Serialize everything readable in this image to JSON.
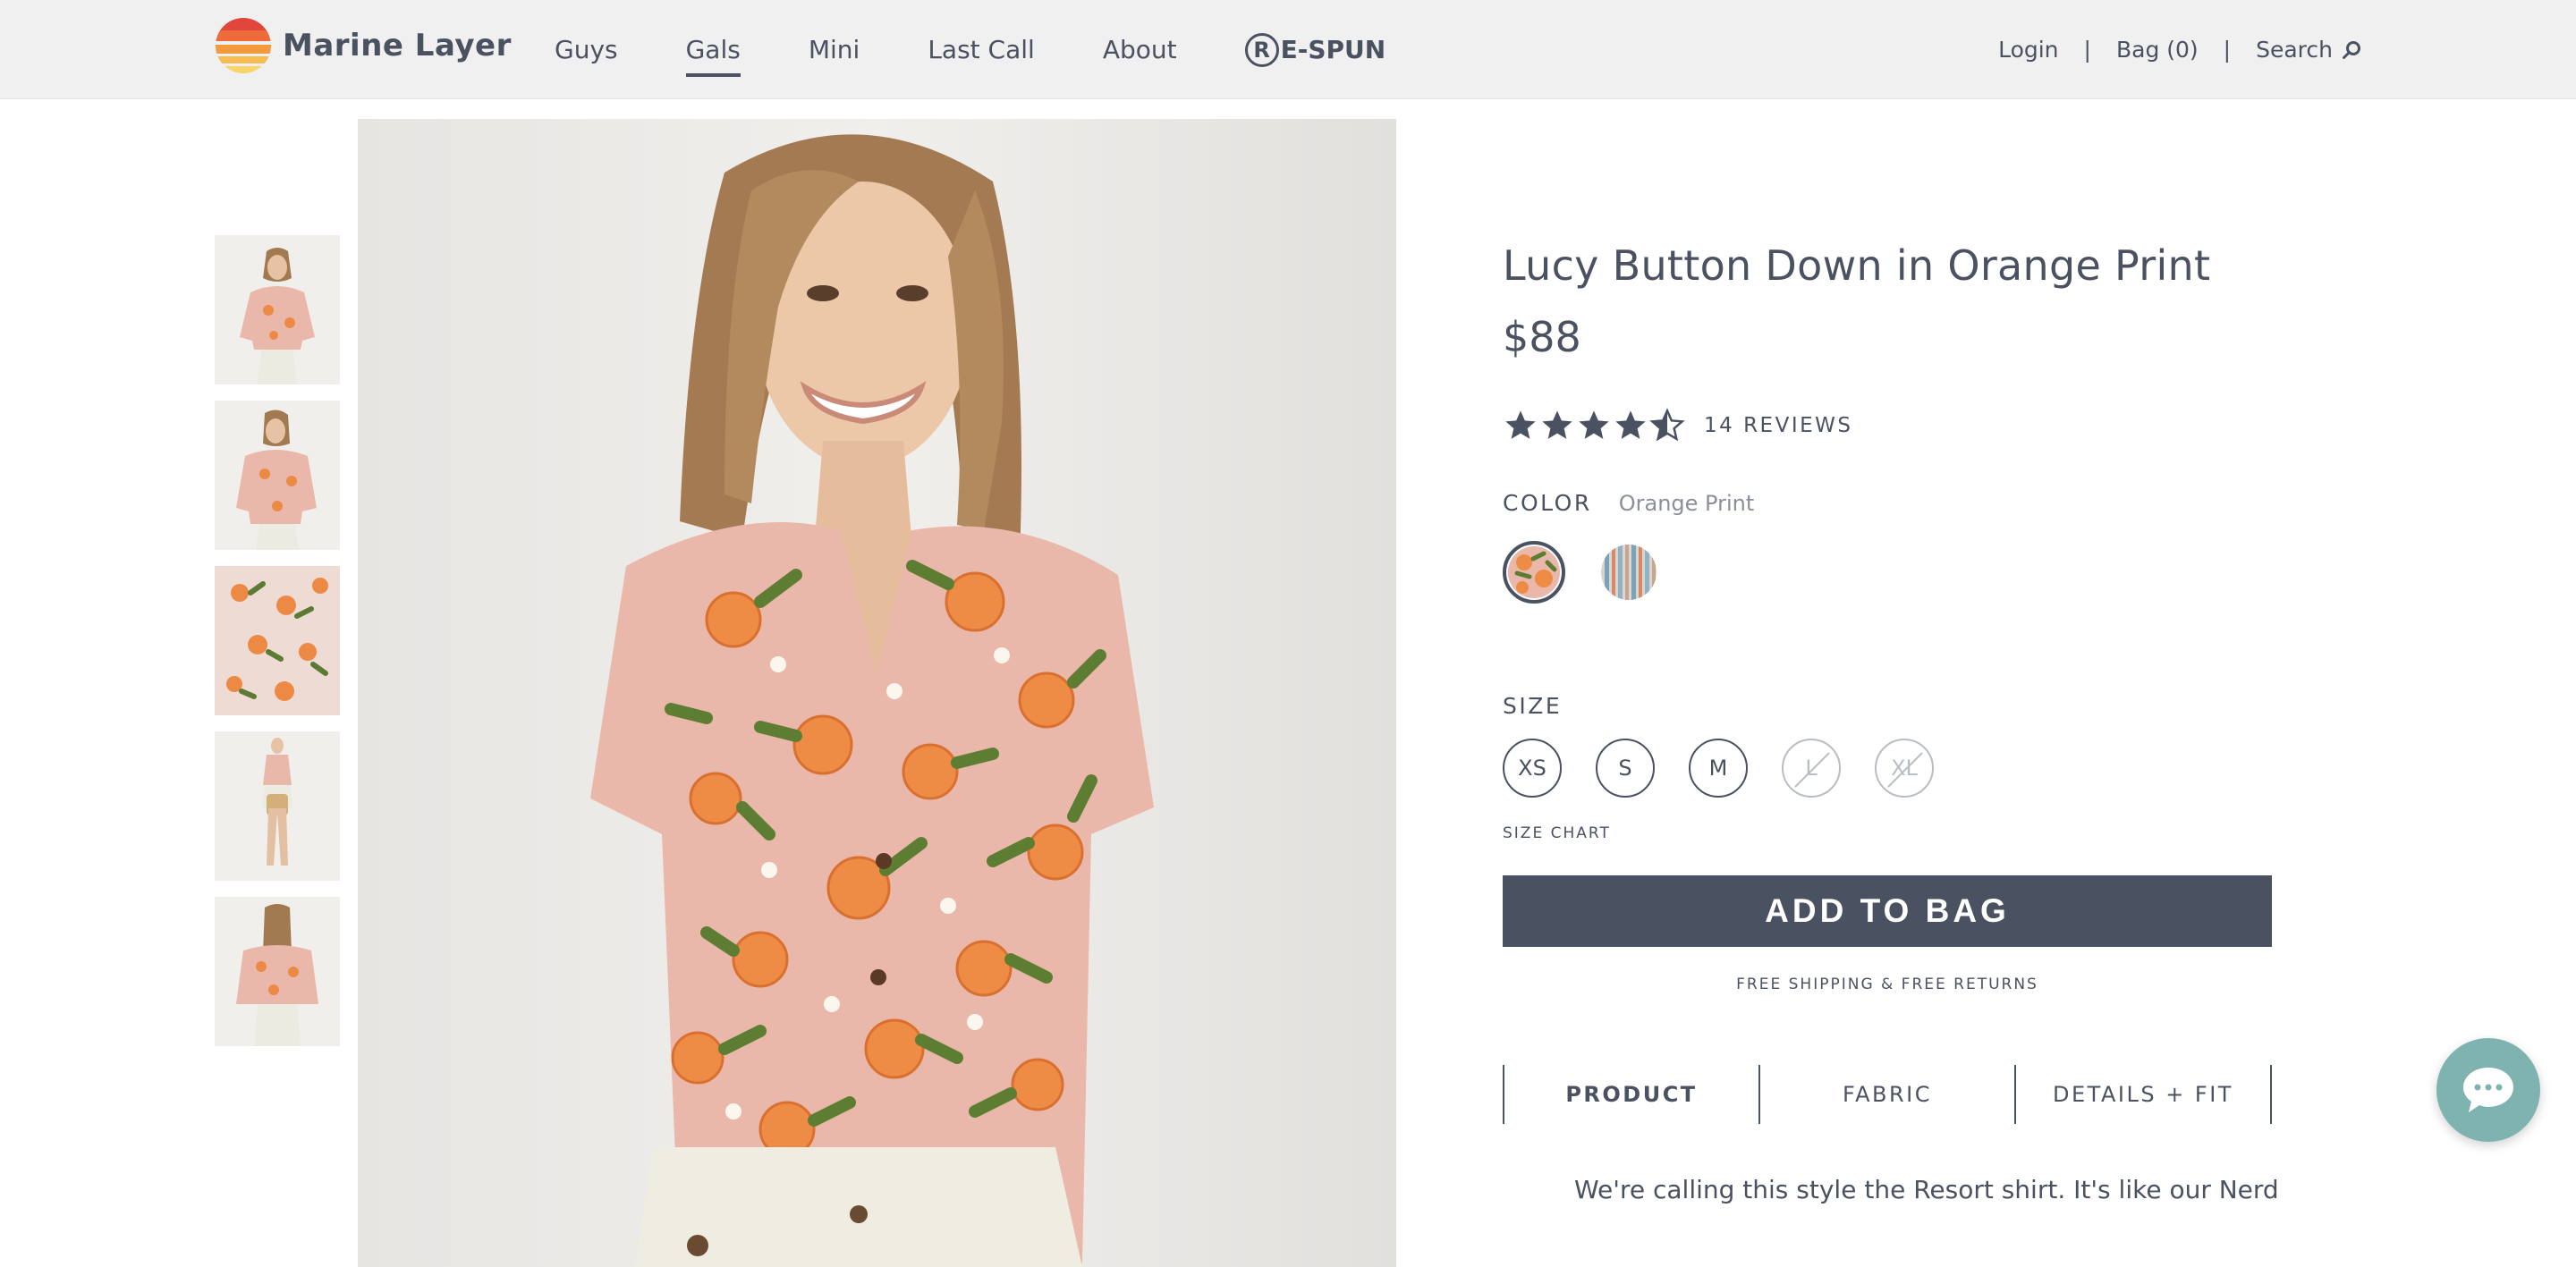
{
  "header": {
    "brand": "Marine Layer",
    "nav": [
      "Guys",
      "Gals",
      "Mini",
      "Last Call",
      "About"
    ],
    "active_nav": "Gals",
    "respun_label": "E-SPUN",
    "login": "Login",
    "separator": "|",
    "bag": "Bag (0)",
    "search": "Search"
  },
  "gallery": {
    "thumbnail_count": 5
  },
  "product": {
    "title": "Lucy Button Down in Orange Print",
    "price": "$88",
    "rating": 4.5,
    "reviews": "14 REVIEWS",
    "color_label": "COLOR",
    "color_value": "Orange Print",
    "swatches": [
      "orange-print",
      "stripe"
    ],
    "size_label": "SIZE",
    "sizes": [
      "XS",
      "S",
      "M",
      "L",
      "XL"
    ],
    "unavailable_sizes": [
      "L",
      "XL"
    ],
    "size_chart": "SIZE CHART",
    "add_to_bag": "ADD TO BAG",
    "shipping_note": "FREE SHIPPING & FREE RETURNS",
    "tabs": [
      "PRODUCT",
      "FABRIC",
      "DETAILS + FIT"
    ],
    "active_tab": "PRODUCT",
    "description": "We're calling this style the Resort shirt. It's like our Nerd"
  },
  "colors": {
    "text": "#4a5160",
    "header_bg": "#f0f0f0",
    "button_bg": "#4a5160",
    "chat_bg": "#7fb3b0"
  }
}
